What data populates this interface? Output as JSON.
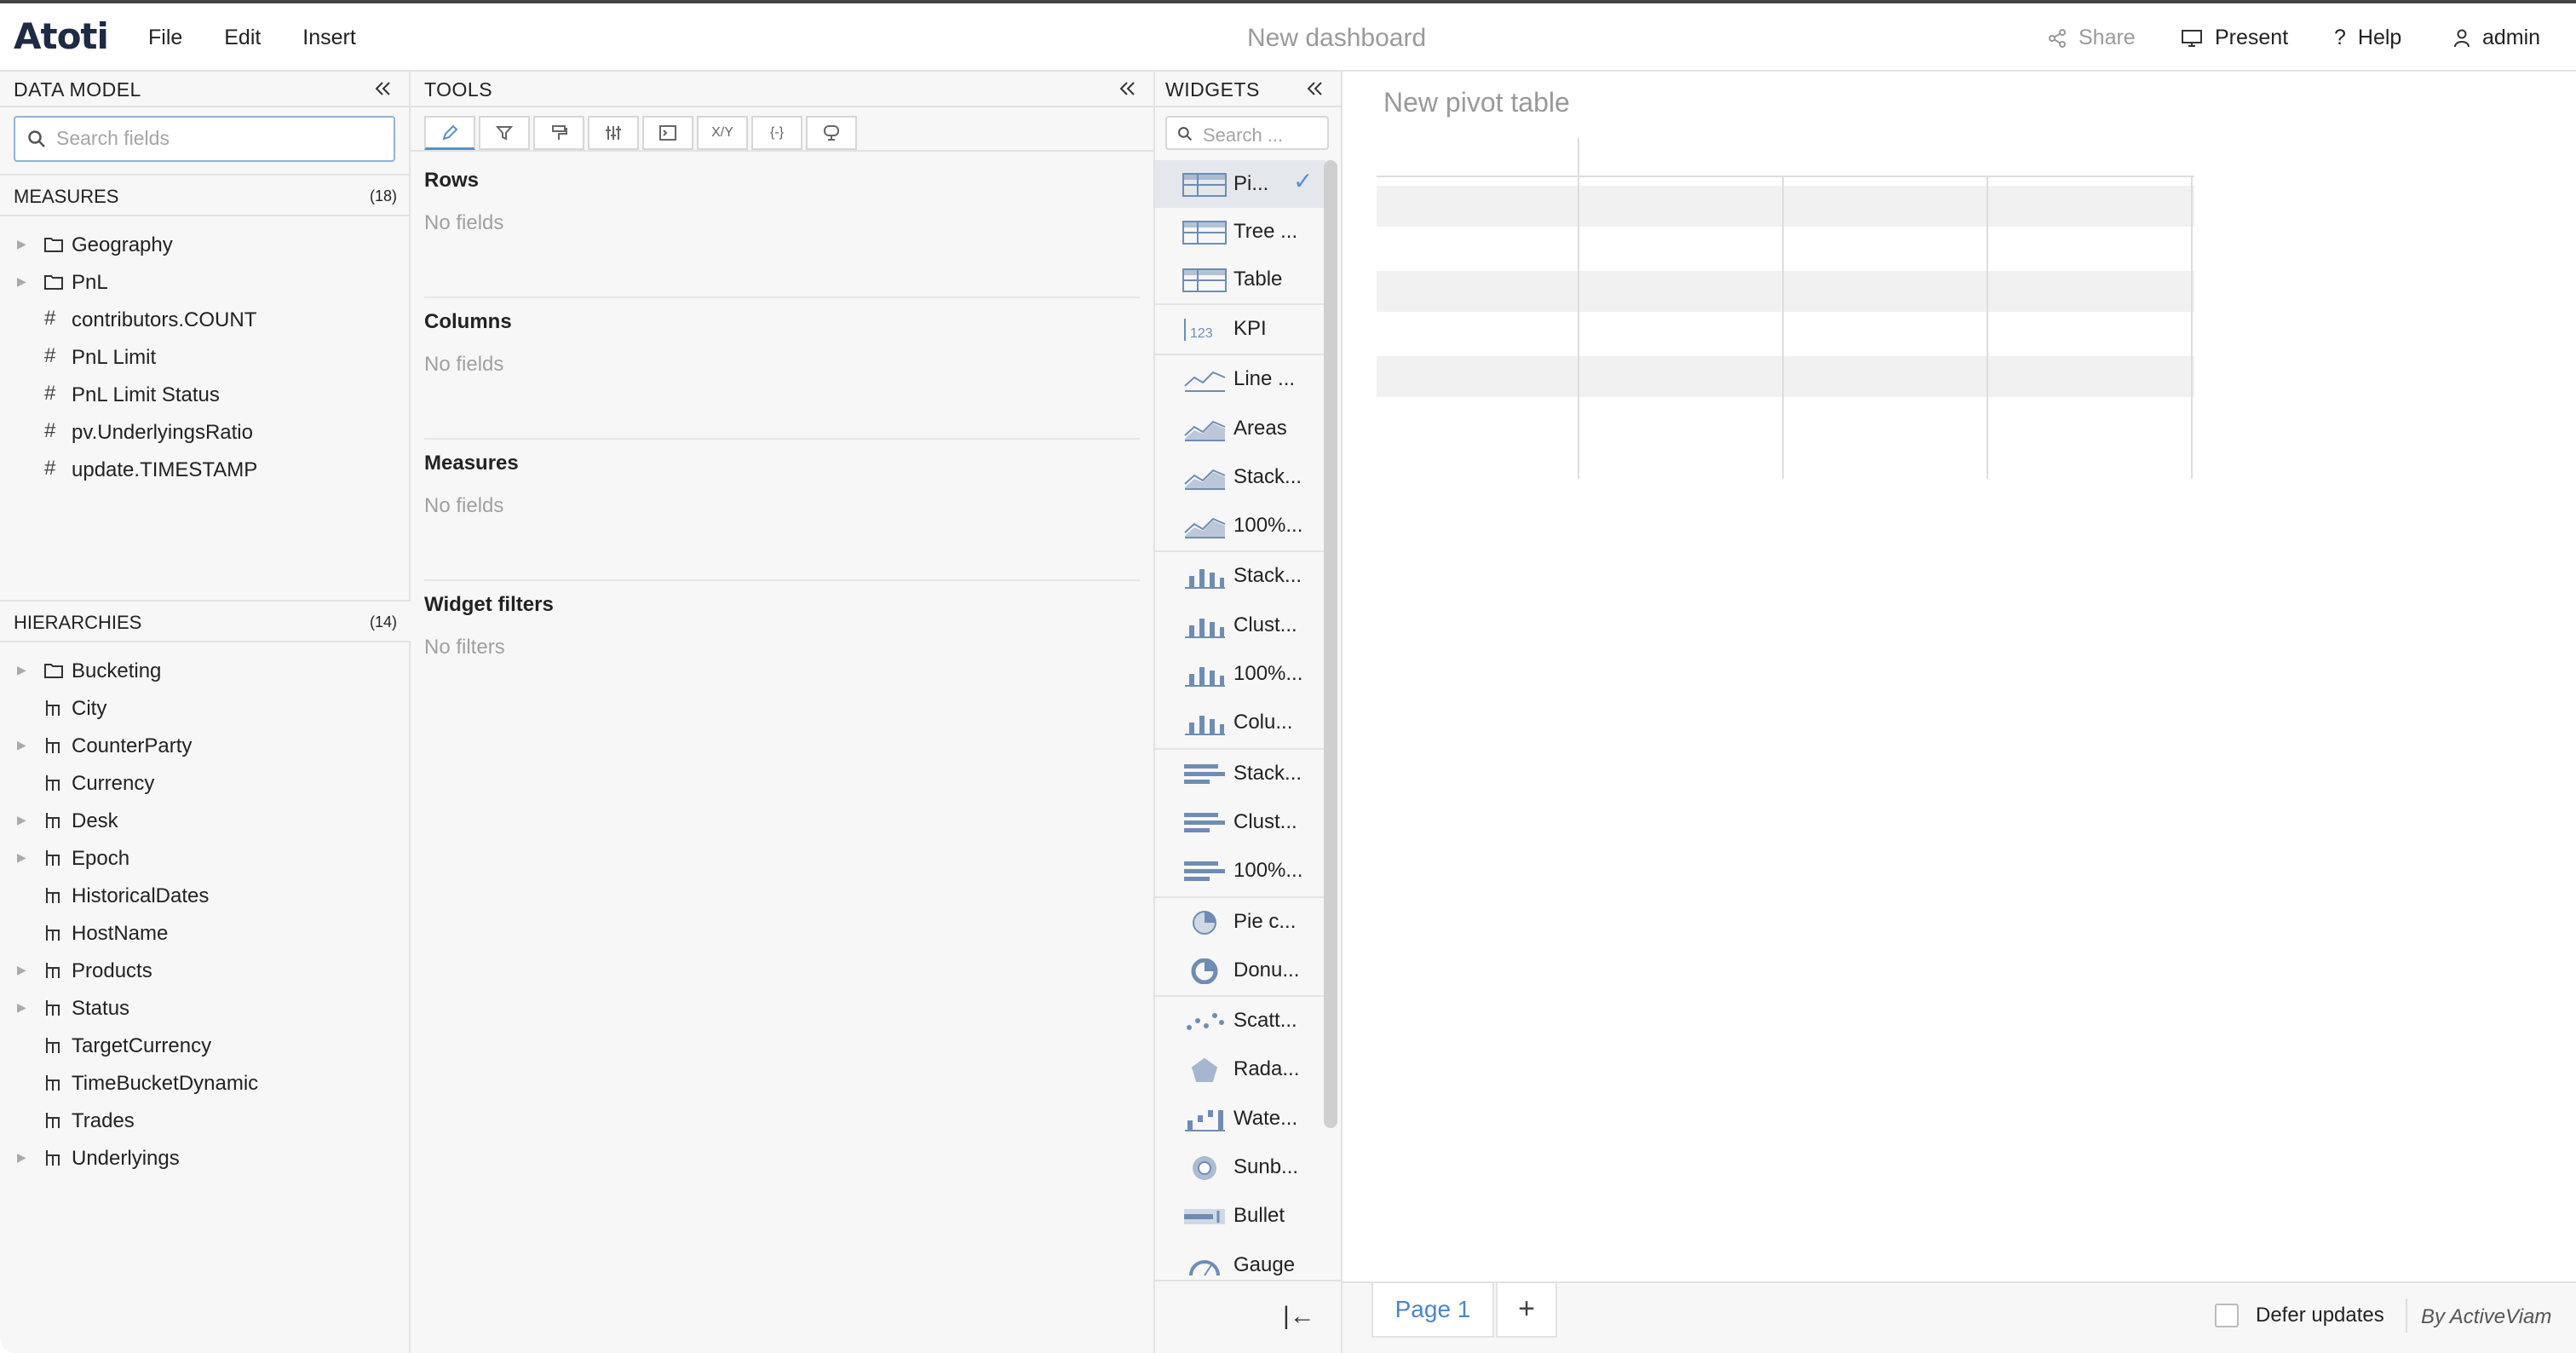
{
  "header": {
    "logo": "Atoti",
    "menu": [
      "File",
      "Edit",
      "Insert"
    ],
    "title": "New dashboard",
    "share": "Share",
    "present": "Present",
    "help": "Help",
    "user": "admin"
  },
  "data_model": {
    "title": "DATA MODEL",
    "search_placeholder": "Search fields",
    "measures_label": "MEASURES",
    "measures_count": "(18)",
    "measures": [
      "Geography",
      "PnL",
      "contributors.COUNT",
      "PnL Limit",
      "PnL Limit Status",
      "pv.UnderlyingsRatio",
      "update.TIMESTAMP"
    ],
    "hierarchies_label": "HIERARCHIES",
    "hierarchies_count": "(14)",
    "hierarchies": [
      "Bucketing",
      "City",
      "CounterParty",
      "Currency",
      "Desk",
      "Epoch",
      "HistoricalDates",
      "HostName",
      "Products",
      "Status",
      "TargetCurrency",
      "TimeBucketDynamic",
      "Trades",
      "Underlyings"
    ]
  },
  "tools": {
    "title": "TOOLS",
    "xy_label": "X/Y",
    "braces_label": "{-}",
    "sections": [
      {
        "heading": "Rows",
        "empty": "No fields"
      },
      {
        "heading": "Columns",
        "empty": "No fields"
      },
      {
        "heading": "Measures",
        "empty": "No fields"
      },
      {
        "heading": "Widget filters",
        "empty": "No filters"
      }
    ]
  },
  "widgets": {
    "title": "WIDGETS",
    "search_placeholder": "Search ...",
    "items": [
      "Pi...",
      "Tree ...",
      "Table",
      "KPI",
      "Line ...",
      "Areas",
      "Stack...",
      "100%...",
      "Stack...",
      "Clust...",
      "100%...",
      "Colu...",
      "Stack...",
      "Clust...",
      "100%...",
      "Pie c...",
      "Donu...",
      "Scatt...",
      "Rada...",
      "Wate...",
      "Sunb...",
      "Bullet",
      "Gauge"
    ],
    "kpi_icon_text": "123"
  },
  "canvas": {
    "title": "New pivot table"
  },
  "footer": {
    "page_tab": "Page 1",
    "add_page": "+",
    "defer_updates": "Defer updates",
    "by": "By ActiveViam"
  },
  "colors": {
    "accent": "#4a86c8",
    "icon_blue": "#6f8db3"
  }
}
